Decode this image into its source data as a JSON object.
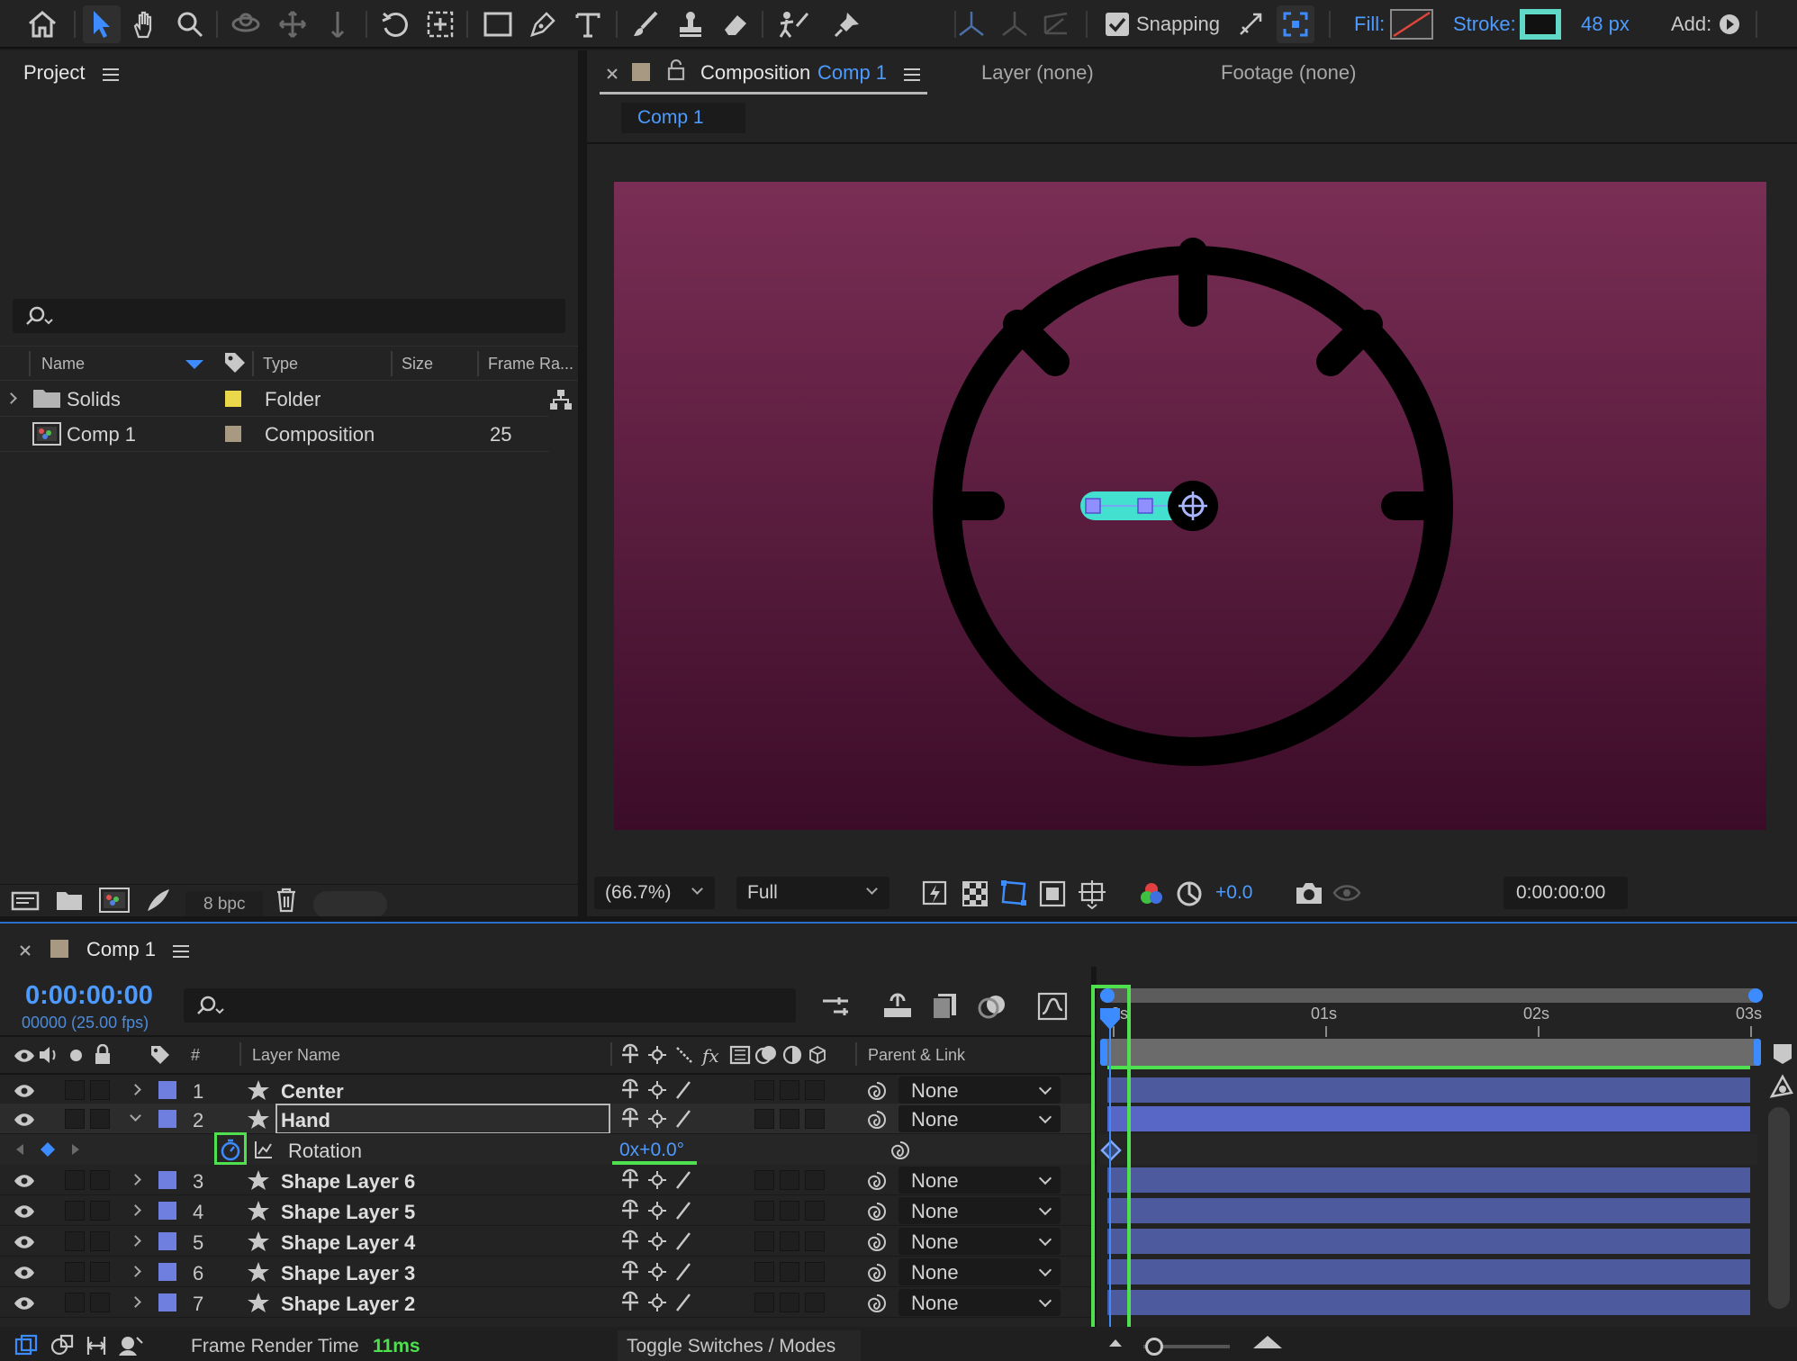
{
  "toolbar": {
    "snapping_label": "Snapping",
    "fill_label": "Fill:",
    "stroke_label": "Stroke:",
    "stroke_width": "48 px",
    "add_label": "Add:",
    "colors": {
      "stroke_swatch": "#5fd8c8",
      "fill_none_slash": "#e0453b",
      "active_tool_bg": "#2f2f2f"
    }
  },
  "project": {
    "title": "Project",
    "search_placeholder": "",
    "columns": [
      "Name",
      "Type",
      "Size",
      "Frame Ra..."
    ],
    "items": [
      {
        "name": "Solids",
        "type": "Folder",
        "size": "",
        "frame_rate": "",
        "label_color": "#e8d84a",
        "icon": "folder-icon"
      },
      {
        "name": "Comp 1",
        "type": "Composition",
        "size": "",
        "frame_rate": "25",
        "label_color": "#a89a82",
        "icon": "composition-icon"
      }
    ],
    "bpc": "8 bpc"
  },
  "viewer": {
    "tab_prefix": "Composition",
    "tab_comp": "Comp 1",
    "layer_tab": "Layer (none)",
    "footage_tab": "Footage (none)",
    "breadcrumb": "Comp 1",
    "zoom": "(66.7%)",
    "resolution": "Full",
    "exposure": "+0.0",
    "timecode": "0:00:00:00",
    "colors": {
      "bg_top": "#7a2e55",
      "bg_bottom": "#3b0c28",
      "hand": "#43e0d0"
    }
  },
  "timeline": {
    "comp_name": "Comp 1",
    "current_time": "0:00:00:00",
    "frame_info": "00000 (25.00 fps)",
    "search_placeholder": "",
    "col_number": "#",
    "col_layer_name": "Layer Name",
    "col_parent": "Parent & Link",
    "ruler": [
      "0s",
      "01s",
      "02s",
      "03s"
    ],
    "layers": [
      {
        "num": "1",
        "name": "Center",
        "parent": "None"
      },
      {
        "num": "2",
        "name": "Hand",
        "parent": "None"
      },
      {
        "num": "3",
        "name": "Shape Layer 6",
        "parent": "None"
      },
      {
        "num": "4",
        "name": "Shape Layer 5",
        "parent": "None"
      },
      {
        "num": "5",
        "name": "Shape Layer 4",
        "parent": "None"
      },
      {
        "num": "6",
        "name": "Shape Layer 3",
        "parent": "None"
      },
      {
        "num": "7",
        "name": "Shape Layer 2",
        "parent": "None"
      }
    ],
    "rotation_label": "Rotation",
    "rotation_value": "0x+0.0°",
    "render_time_label": "Frame Render Time",
    "render_time_value": "11ms",
    "toggle_label": "Toggle Switches / Modes",
    "colors": {
      "layer_label": "#6f7fe0",
      "track": "#4d5a9d",
      "highlight": "#4ee04e"
    }
  }
}
